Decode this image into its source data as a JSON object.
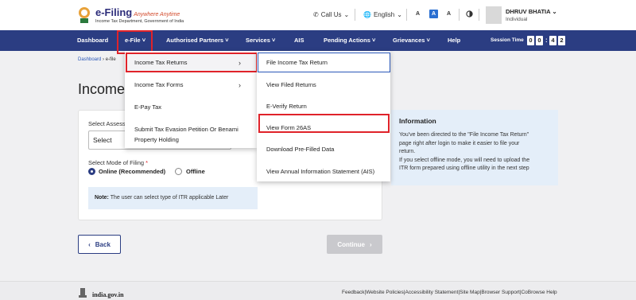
{
  "header": {
    "logo_title": "e-Filing",
    "logo_tagline": "Anywhere Anytime",
    "logo_subtitle": "Income Tax Department, Government of India",
    "call_us": "Call Us",
    "language": "English",
    "font_decrease": "A",
    "font_reset": "A",
    "font_increase": "A",
    "user_name": "DHRUV BHATIA",
    "user_role": "Individual"
  },
  "nav": {
    "items": [
      "Dashboard",
      "e-File",
      "Authorised Partners",
      "Services",
      "AIS",
      "Pending Actions",
      "Grievances",
      "Help"
    ],
    "session_label": "Session Time",
    "session_digits": [
      "0",
      "0",
      "4",
      "2"
    ]
  },
  "breadcrumb": [
    "Dashboard",
    "e-file"
  ],
  "page_title": "Income T",
  "form": {
    "assessment_label": "Select Assess",
    "assessment_value": "Select",
    "mode_label": "Select Mode of Filing",
    "mode_required": "*",
    "mode_options": [
      "Online (Recommended)",
      "Offline"
    ],
    "note_label": "Note:",
    "note_text": "The user can select type of ITR applicable Later"
  },
  "info": {
    "title": "Information",
    "lines": [
      "You've been directed to the \"File Income Tax Return\"",
      "page right after login to make it easier to file your",
      "return.",
      "If you select offline mode, you will need to upload the",
      "ITR form prepared using offline utility in the next step"
    ]
  },
  "buttons": {
    "back": "Back",
    "continue": "Continue"
  },
  "footer": {
    "site": "india.gov.in",
    "links": [
      "Feedback",
      "|Website Policies",
      "|Accessibility Statement",
      "|Site Map",
      "|Browser Support",
      "|CoBrowse Help"
    ]
  },
  "efile_menu": {
    "items": [
      "Income Tax Returns",
      "Income Tax Forms",
      "E-Pay Tax",
      "Submit Tax Evasion Petition Or Benami",
      "Property Holding"
    ]
  },
  "itr_submenu": {
    "items": [
      "File Income Tax Return",
      "View Filed Returns",
      "E-Verify Return",
      "View Form 26AS",
      "Download Pre-Filled Data",
      "View Annual Information Statement (AIS)"
    ]
  },
  "colors": {
    "nav_bg": "#2b3d82",
    "highlight_red": "#e0232a",
    "info_bg": "#e4eef9"
  }
}
